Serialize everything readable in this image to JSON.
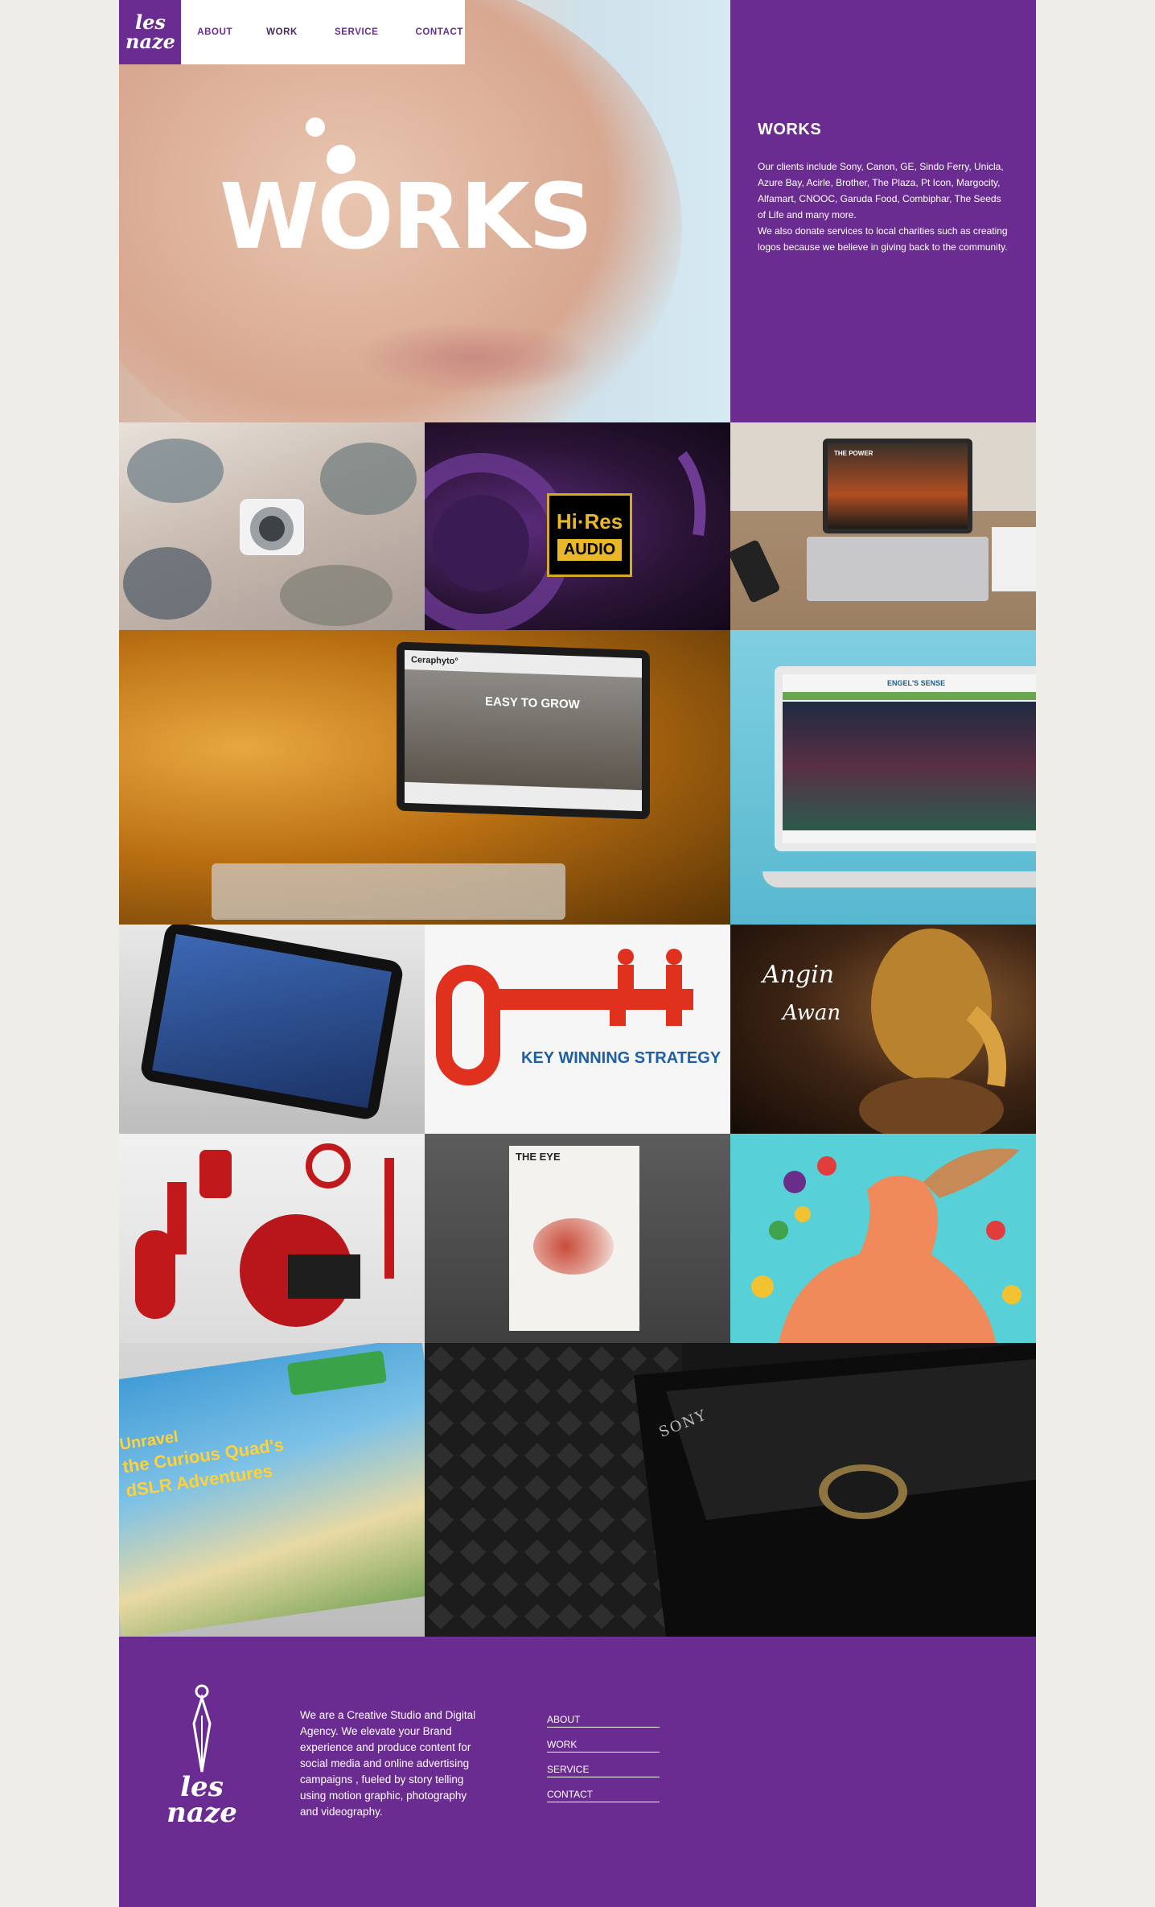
{
  "brand": {
    "logo_text": "les\nnazes",
    "accent": "#6b2c91"
  },
  "nav": {
    "items": [
      {
        "label": "ABOUT"
      },
      {
        "label": "WORK"
      },
      {
        "label": "SERVICE"
      },
      {
        "label": "CONTACT"
      }
    ]
  },
  "hero": {
    "title": "WORKS"
  },
  "intro": {
    "heading": "WORKS",
    "body": "Our clients include Sony, Canon, GE, Sindo Ferry, Unicla, Azure Bay, Acirle, Brother, The Plaza, Pt Icon, Margocity, Alfamart, CNOOC, Garuda Food, Combiphar, The Seeds of Life and many more.",
    "body2": "We also donate services to local charities such as creating logos because we believe in giving back to the community."
  },
  "tiles": {
    "hires_line1": "Hi·Res",
    "hires_line2": "AUDIO",
    "camera_site": "THE POWER",
    "ceraphyto_brand": "Ceraphyto°",
    "ceraphyto_headline": "EASY TO GROW",
    "engels_brand": "ENGEL'S SENSE",
    "key_strategy": "KEY WINNING STRATEGY",
    "angin_line1": "Angin",
    "angin_line2": "Awan",
    "eye_title": "THE EYE",
    "curious_line1": "Unravel",
    "curious_line2": "the Curious Quad's",
    "curious_line3": "dSLR Adventures",
    "sony_label": "SONY"
  },
  "footer": {
    "description": "We are a Creative Studio and Digital Agency. We elevate your Brand experience and produce content for social media and online advertising campaigns , fueled by story telling using motion graphic, photography and videography.",
    "links": [
      {
        "label": "ABOUT"
      },
      {
        "label": "WORK"
      },
      {
        "label": "SERVICE"
      },
      {
        "label": "CONTACT"
      }
    ]
  }
}
